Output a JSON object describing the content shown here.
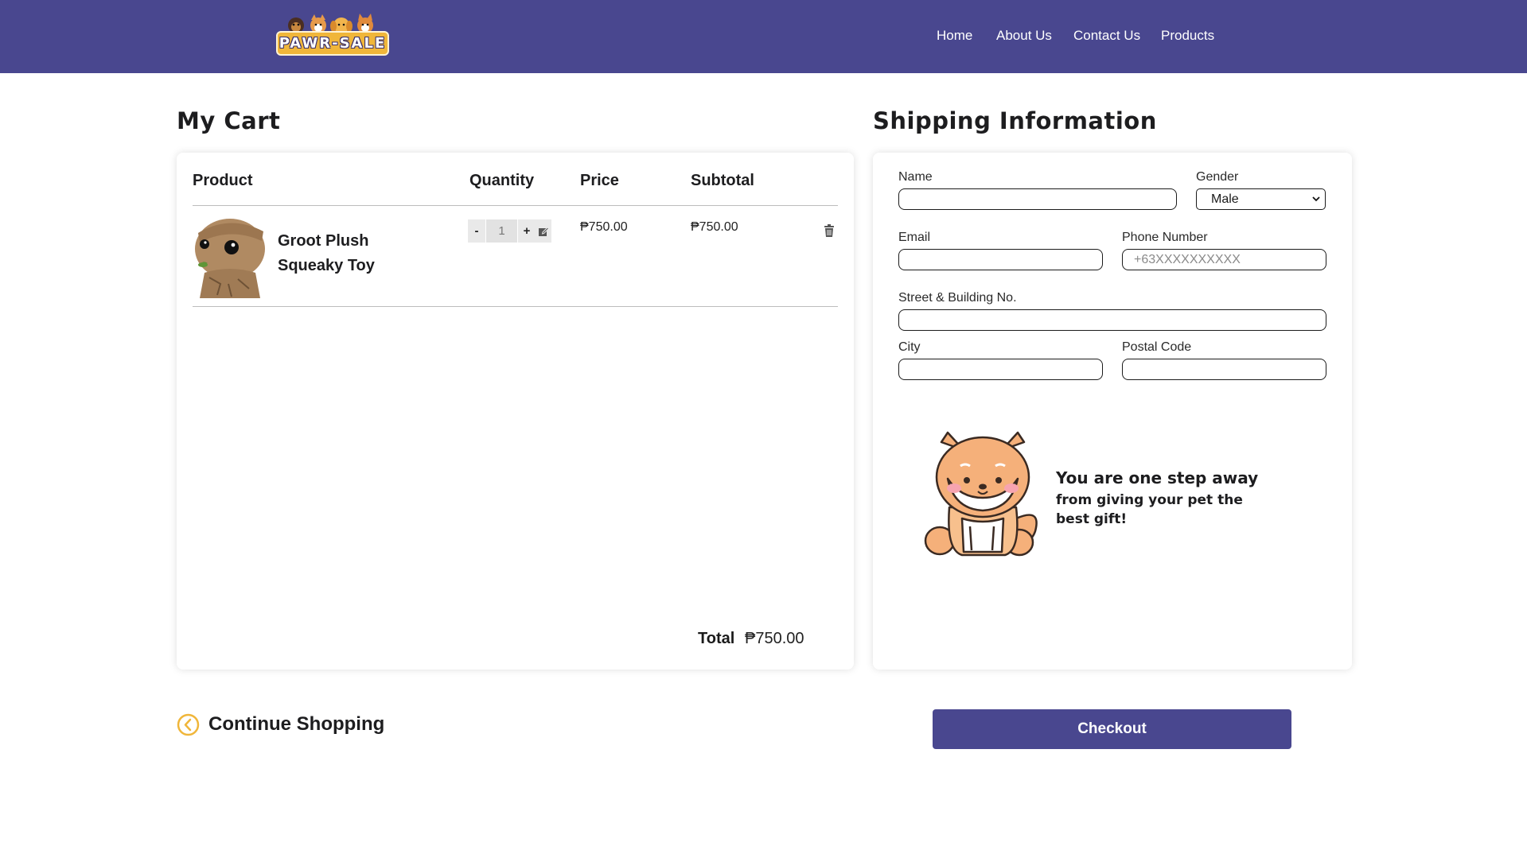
{
  "header": {
    "brand": "PAWR-SALE",
    "nav": [
      {
        "label": "Home"
      },
      {
        "label": "About Us"
      },
      {
        "label": "Contact Us"
      },
      {
        "label": "Products"
      }
    ],
    "background_color": "#49478f"
  },
  "cart": {
    "title": "My Cart",
    "columns": {
      "product": "Product",
      "quantity": "Quantity",
      "price": "Price",
      "subtotal": "Subtotal"
    },
    "items": [
      {
        "name": "Groot Plush Squeaky Toy",
        "quantity": "1",
        "price": "₱750.00",
        "subtotal": "₱750.00",
        "decrement_label": "-",
        "increment_label": "+",
        "edit_icon": "edit-icon",
        "delete_icon": "trash-icon"
      }
    ],
    "total_label": "Total",
    "total_value": "₱750.00"
  },
  "shipping": {
    "title": "Shipping Information",
    "fields": {
      "name": {
        "label": "Name",
        "value": ""
      },
      "gender": {
        "label": "Gender",
        "value": "Male"
      },
      "email": {
        "label": "Email",
        "value": ""
      },
      "phone": {
        "label": "Phone Number",
        "placeholder": "+63XXXXXXXXXX",
        "value": ""
      },
      "street": {
        "label": "Street & Building No.",
        "value": ""
      },
      "city": {
        "label": "City",
        "value": ""
      },
      "postal": {
        "label": "Postal Code",
        "value": ""
      }
    },
    "promo_line1": "You are one step away",
    "promo_line2": "from giving your pet the best gift!"
  },
  "actions": {
    "continue_label": "Continue Shopping",
    "checkout_label": "Checkout",
    "accent_color": "#f0b63a"
  }
}
